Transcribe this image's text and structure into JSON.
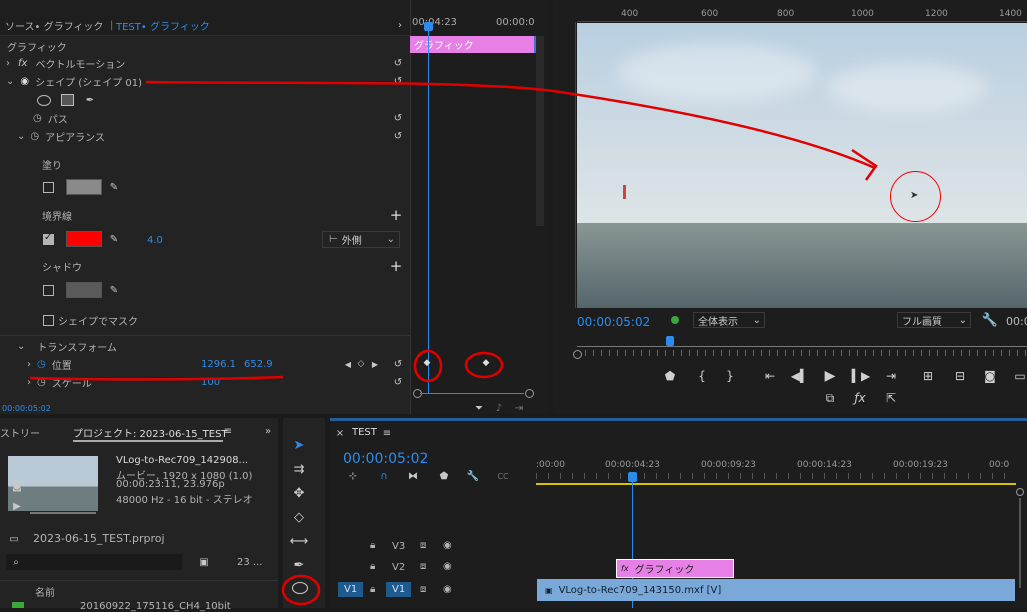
{
  "source_tabs": {
    "source": "ソース• グラフィック",
    "effects": "TEST• グラフィック"
  },
  "ec": {
    "timecode_top": "00:04:23",
    "timecode_top2": "00:00:0",
    "clip_label": "グラフィック",
    "graphic_header": "グラフィック",
    "fx_label": "fx",
    "vector_motion": "ベクトルモーション",
    "shape_layer": "シェイプ (シェイプ 01)",
    "path": "パス",
    "appearance": "アピアランス",
    "fill": "塗り",
    "stroke": "境界線",
    "stroke_width": "4.0",
    "stroke_position": "外側",
    "shadow": "シャドウ",
    "mask": "シェイプでマスク",
    "transform": "トランスフォーム",
    "position_label": "位置",
    "pos_x": "1296.1",
    "pos_y": "652.9",
    "scale_label": "スケール",
    "scale_value": "100",
    "bottom_tc": "00:00:05:02",
    "colors": {
      "fill": "#8a8a8a",
      "stroke": "#ff0000",
      "shadow": "#5a5a5a"
    }
  },
  "monitor": {
    "ruler_labels": [
      "400",
      "600",
      "800",
      "1000",
      "1200",
      "1400"
    ],
    "timecode": "00:00:05:02",
    "zoom": "全体表示",
    "quality": "フル画質",
    "tc_right": "00:0"
  },
  "project": {
    "history_tab": "ストリー",
    "project_tab": "プロジェクト: 2023-06-15_TEST",
    "clip_name": "VLog-to-Rec709_142908...",
    "clip_info1": "ムービー, 1920 x 1080 (1.0)",
    "clip_info2": "00:00:23:11, 23.976p",
    "clip_info3": "48000 Hz - 16 bit - ステレオ",
    "project_file": "2023-06-15_TEST.prproj",
    "count": "23 ...",
    "name_header": "名前",
    "row1": "20160922_175116_CH4_10bit"
  },
  "timeline": {
    "tab": "TEST",
    "timecode": "00:00:05:02",
    "ruler": [
      ":00:00",
      "00:00:04:23",
      "00:00:09:23",
      "00:00:14:23",
      "00:00:19:23",
      "00:0"
    ],
    "tracks": [
      "V3",
      "V2",
      "V1"
    ],
    "src_patch": "V1",
    "graphic_clip": "グラフィック",
    "video_clip": "VLog-to-Rec709_143150.mxf [V]"
  }
}
